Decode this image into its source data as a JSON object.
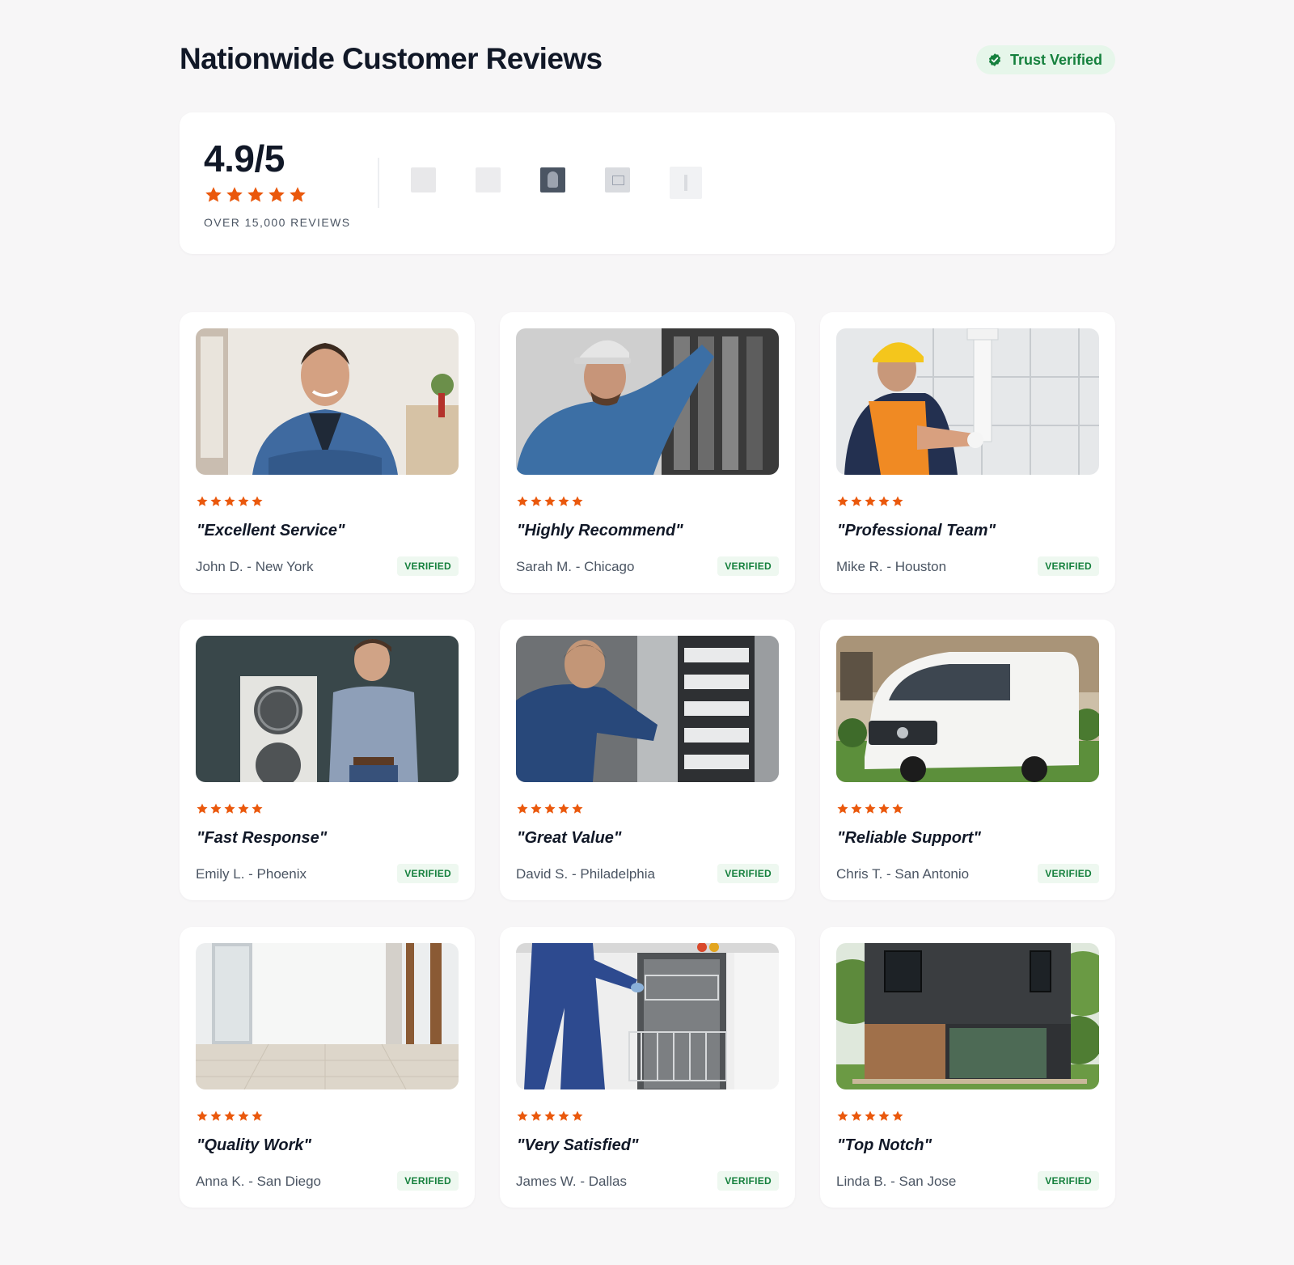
{
  "header": {
    "title": "Nationwide Customer Reviews",
    "badge_label": "Trust Verified",
    "badge_icon": "check-badge-icon"
  },
  "summary": {
    "rating": "4.9/5",
    "stars": 5,
    "reviews_label": "OVER 15,000 REVIEWS",
    "logos": [
      "partner-logo-1",
      "partner-logo-2",
      "partner-logo-3",
      "partner-logo-4",
      "partner-logo-5"
    ]
  },
  "colors": {
    "background": "#f7f6f7",
    "card": "#ffffff",
    "star": "#ea580c",
    "verified_text": "#15803d",
    "verified_bg": "#eef8f0",
    "title": "#111827",
    "muted": "#4b5563"
  },
  "reviews": [
    {
      "photo": "smiling-man-denim-shirt",
      "stars": 5,
      "quote": "\"Excellent Service\"",
      "author": "John D. - New York",
      "badge": "VERIFIED"
    },
    {
      "photo": "electrician-at-panel",
      "stars": 5,
      "quote": "\"Highly Recommend\"",
      "author": "Sarah M. - Chicago",
      "badge": "VERIFIED"
    },
    {
      "photo": "plumber-fixing-pipe",
      "stars": 5,
      "quote": "\"Professional Team\"",
      "author": "Mike R. - Houston",
      "badge": "VERIFIED"
    },
    {
      "photo": "technician-with-ac-unit",
      "stars": 5,
      "quote": "\"Fast Response\"",
      "author": "Emily L. - Phoenix",
      "badge": "VERIFIED"
    },
    {
      "photo": "technician-at-breaker-box",
      "stars": 5,
      "quote": "\"Great Value\"",
      "author": "David S. - Philadelphia",
      "badge": "VERIFIED"
    },
    {
      "photo": "white-service-van",
      "stars": 5,
      "quote": "\"Reliable Support\"",
      "author": "Chris T. - San Antonio",
      "badge": "VERIFIED"
    },
    {
      "photo": "empty-renovated-room",
      "stars": 5,
      "quote": "\"Quality Work\"",
      "author": "Anna K. - San Diego",
      "badge": "VERIFIED"
    },
    {
      "photo": "dishwasher-repair",
      "stars": 5,
      "quote": "\"Very Satisfied\"",
      "author": "James W. - Dallas",
      "badge": "VERIFIED"
    },
    {
      "photo": "modern-house-exterior",
      "stars": 5,
      "quote": "\"Top Notch\"",
      "author": "Linda B. - San Jose",
      "badge": "VERIFIED"
    }
  ]
}
